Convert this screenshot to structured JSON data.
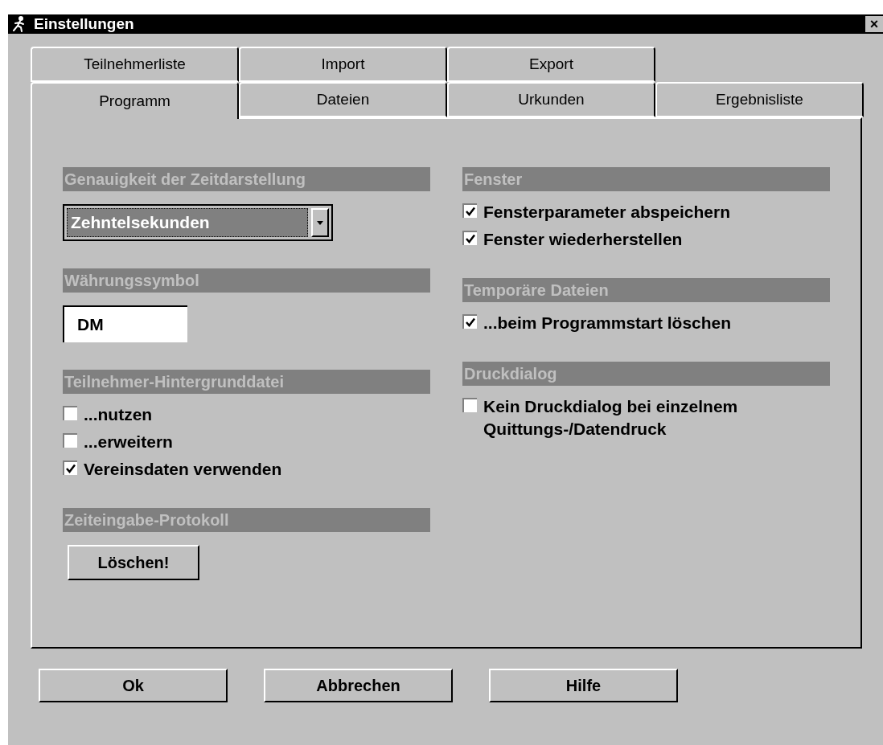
{
  "window": {
    "title": "Einstellungen",
    "close": "×"
  },
  "tab_rows": [
    [
      {
        "label": "Teilnehmerliste",
        "selected": false
      },
      {
        "label": "Import",
        "selected": false
      },
      {
        "label": "Export",
        "selected": false
      }
    ],
    [
      {
        "label": "Programm",
        "selected": true
      },
      {
        "label": "Dateien",
        "selected": false
      },
      {
        "label": "Urkunden",
        "selected": false
      },
      {
        "label": "Ergebnisliste",
        "selected": false
      }
    ]
  ],
  "columns": [
    [
      {
        "title": "Genauigkeit der Zeitdarstellung",
        "kind": "dropdown",
        "value": "Zehntelsekunden"
      },
      {
        "title": "Währungssymbol",
        "kind": "text",
        "value": "DM"
      },
      {
        "title": "Teilnehmer-Hintergrunddatei",
        "kind": "checkboxes",
        "items": [
          {
            "label": "...nutzen",
            "checked": false
          },
          {
            "label": "...erweitern",
            "checked": false
          },
          {
            "label": "Vereinsdaten verwenden",
            "checked": true
          }
        ]
      },
      {
        "title": "Zeiteingabe-Protokoll",
        "kind": "button",
        "label": "Löschen!"
      }
    ],
    [
      {
        "title": "Fenster",
        "kind": "checkboxes",
        "items": [
          {
            "label": "Fensterparameter abspeichern",
            "checked": true
          },
          {
            "label": "Fenster wiederherstellen",
            "checked": true
          }
        ]
      },
      {
        "title": "Temporäre Dateien",
        "kind": "checkboxes",
        "items": [
          {
            "label": "...beim Programmstart löschen",
            "checked": true
          }
        ]
      },
      {
        "title": "Druckdialog",
        "kind": "checkboxes",
        "items": [
          {
            "label": "Kein Druckdialog bei einzelnem Quittungs-/Datendruck",
            "checked": false
          }
        ]
      }
    ]
  ],
  "buttons": [
    "Ok",
    "Abbrechen",
    "Hilfe"
  ]
}
